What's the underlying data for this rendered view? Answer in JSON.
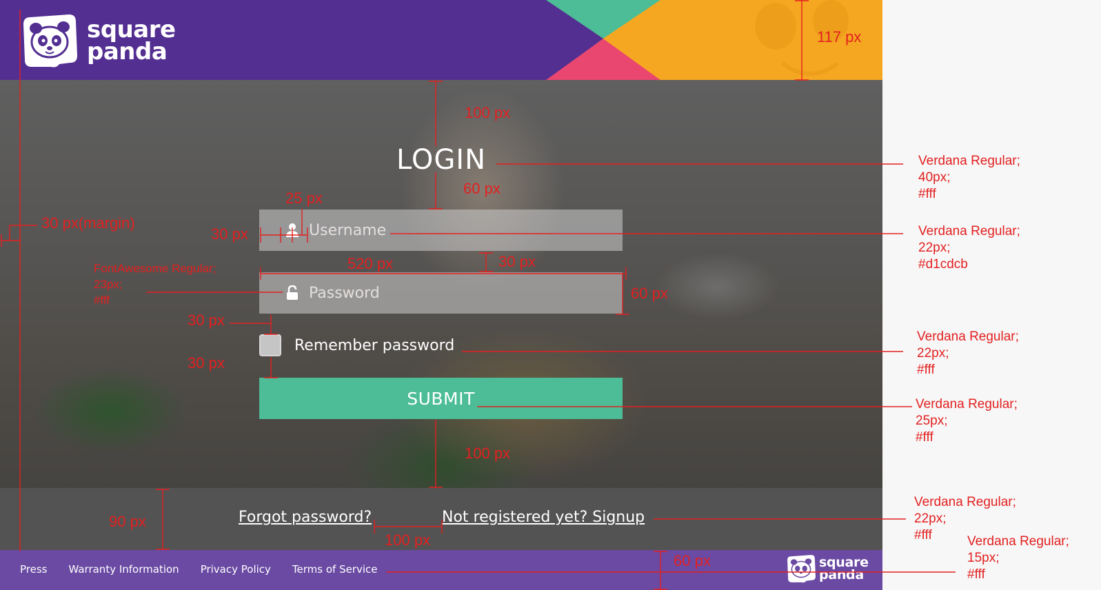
{
  "brand": {
    "wordmark_line1": "square",
    "wordmark_line2": "panda",
    "colors": {
      "header_purple": "#532f92",
      "footer_purple": "#6a4aa3",
      "accent_green": "#4cbd96",
      "accent_orange": "#f6a721",
      "accent_pink": "#e9476f",
      "annotation_red": "#e32020"
    }
  },
  "login": {
    "title": "LOGIN",
    "username_placeholder": "Username",
    "password_placeholder": "Password",
    "username_icon": "user-icon",
    "password_icon": "unlock-icon",
    "remember_label": "Remember password",
    "submit_label": "SUBMIT"
  },
  "links": {
    "forgot": "Forgot password?",
    "signup": "Not registered yet? Signup"
  },
  "footer": {
    "nav": [
      "Press",
      "Warranty Information",
      "Privacy Policy",
      "Terms of Service"
    ]
  },
  "annotations": {
    "dimensions": {
      "header_height": "117 px",
      "top_to_title": "100 px",
      "title_to_field": "60 px",
      "icon_gap": "25 px",
      "margin_left": "30 px(margin)",
      "icon_left": "30 px",
      "field_width": "520 px",
      "field_gap": "30 px",
      "field_height": "60 px",
      "pw_to_remember": "30 px",
      "remember_to_submit": "30 px",
      "submit_to_bar": "100 px",
      "bar_height": "90 px",
      "link_gap": "100 px",
      "footer_height": "60 px"
    },
    "specs": {
      "fontawesome": [
        "FontAwesome Regular;",
        "23px;",
        "#fff"
      ],
      "title": [
        "Verdana Regular;",
        "40px;",
        "#fff"
      ],
      "input": [
        "Verdana Regular;",
        "22px;",
        "#d1cdcb"
      ],
      "remember": [
        "Verdana Regular;",
        "22px;",
        "#fff"
      ],
      "submit": [
        "Verdana Regular;",
        "25px;",
        "#fff"
      ],
      "links": [
        "Verdana Regular;",
        "22px;",
        "#fff"
      ],
      "footer": [
        "Verdana Regular;",
        "15px;",
        "#fff"
      ]
    }
  }
}
